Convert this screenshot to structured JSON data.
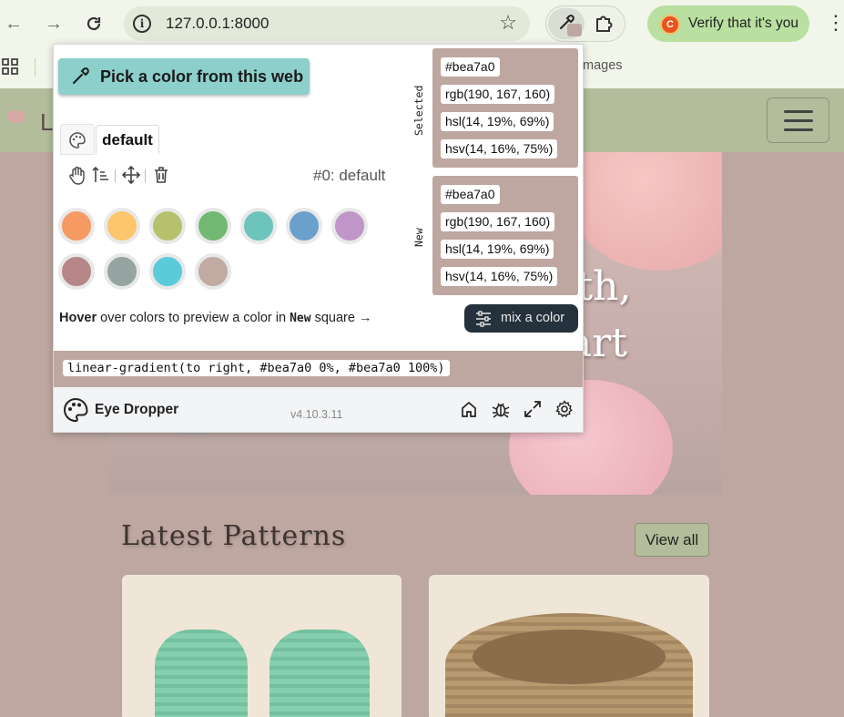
{
  "browser": {
    "url": "127.0.0.1:8000",
    "verify_label": "Verify that it's you",
    "verify_avatar_letter": "C",
    "bookmark_images_label": "Images",
    "nav_icons": [
      "back-arrow-icon",
      "forward-arrow-icon",
      "reload-icon",
      "site-info-icon",
      "bookmark-star-icon",
      "eyedropper-extension-icon",
      "extensions-puzzle-icon",
      "kebab-menu-icon",
      "apps-grid-icon"
    ]
  },
  "site": {
    "brand_letter": "L",
    "hero_line1": "oth,",
    "hero_line2": "art",
    "section_title": "Latest Patterns",
    "view_all_label": "View all"
  },
  "eyedropper": {
    "pick_button_label": "Pick a color from this web",
    "palette_tab_label": "default",
    "palette_name": "#0: default",
    "palette_colors": [
      "#f59a63",
      "#fdc66c",
      "#b6c16e",
      "#72b873",
      "#6cc4bd",
      "#6b9fcc",
      "#c095c8",
      "#b68688",
      "#95a4a0",
      "#5bcbdc",
      "#c1aaa2"
    ],
    "hint": {
      "bold_word": "Hover",
      "text_before_new": " over colors to preview a color in ",
      "new_word": "New",
      "text_after_new": " square →"
    },
    "mix_button_label": "mix a color",
    "gradient_css": "linear-gradient(to right, #bea7a0 0%, #bea7a0 100%)",
    "selected": {
      "label": "Selected",
      "color": "#bea7a0",
      "hex": "#bea7a0",
      "rgb": "rgb(190, 167, 160)",
      "hsl": "hsl(14, 19%, 69%)",
      "hsv": "hsv(14, 16%, 75%)"
    },
    "new": {
      "label": "New",
      "color": "#bea7a0",
      "hex": "#bea7a0",
      "rgb": "rgb(190, 167, 160)",
      "hsl": "hsl(14, 19%, 69%)",
      "hsv": "hsv(14, 16%, 75%)"
    },
    "footer": {
      "name": "Eye Dropper",
      "version": "v4.10.3.11"
    }
  }
}
